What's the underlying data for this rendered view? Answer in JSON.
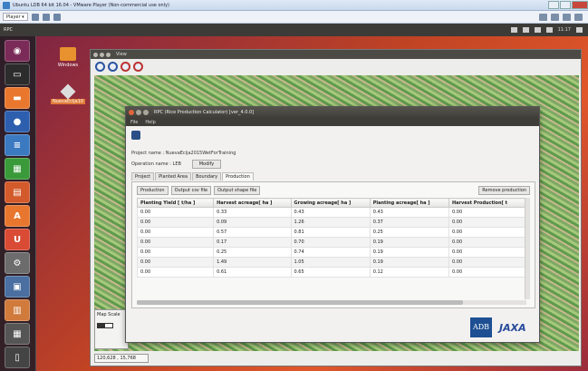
{
  "vm": {
    "title": "Ubuntu LDB 64 bit 16.04 - VMware Player (Non-commercial use only)",
    "menu_label": "Player ▾"
  },
  "panel": {
    "app_name": "RPC",
    "time": "11:17"
  },
  "desktop": {
    "icons": [
      {
        "label": "Windows"
      },
      {
        "label": "NuevaEcija10"
      }
    ]
  },
  "launcher": {
    "items": [
      "dash-icon",
      "terminal-icon",
      "files-icon",
      "firefox-icon",
      "writer-icon",
      "calc-icon",
      "impress-icon",
      "software-icon",
      "ubuntu-one-icon",
      "settings-icon",
      "screen-icon",
      "archive-icon",
      "workspace-icon",
      "trash-icon"
    ]
  },
  "viewer": {
    "title": "View",
    "map_scale_label": "Map Scale",
    "coords": "120,628 , 15,768"
  },
  "dialog": {
    "title": "RPC (Rice Production Calculator) [ver_4.0.0]",
    "menu": [
      "File",
      "Help"
    ],
    "project_name_label": "Project name :",
    "project_name_value": "NuevaEcija2015WetForTraining",
    "operation_name_label": "Operation name :",
    "operation_name_value": "LEB",
    "modify_label": "Modify",
    "tabs": [
      "Project",
      "Planted Area",
      "Boundary",
      "Production"
    ],
    "buttons": {
      "production": "Production",
      "output_csv": "Output csv file",
      "output_shape": "Output shape file",
      "remove": "Remove production"
    },
    "table": {
      "columns": [
        "Planting Yield [ t/ha ]",
        "Harvest acreage[ ha ]",
        "Growing acreage[ ha ]",
        "Planting acreage[ ha ]",
        "Harvest Production[ t"
      ],
      "rows": [
        [
          "0.00",
          "0.33",
          "0.43",
          "0.43",
          "0.00"
        ],
        [
          "0.00",
          "0.09",
          "1.26",
          "0.37",
          "0.00"
        ],
        [
          "0.00",
          "0.57",
          "0.81",
          "0.25",
          "0.00"
        ],
        [
          "0.00",
          "0.17",
          "0.70",
          "0.19",
          "0.00"
        ],
        [
          "0.00",
          "0.25",
          "0.74",
          "0.19",
          "0.00"
        ],
        [
          "0.00",
          "1.49",
          "1.05",
          "0.19",
          "0.00"
        ],
        [
          "0.00",
          "0.61",
          "0.65",
          "0.12",
          "0.00"
        ]
      ]
    },
    "logos": {
      "adb": "ADB",
      "jaxa": "JAXA"
    }
  }
}
